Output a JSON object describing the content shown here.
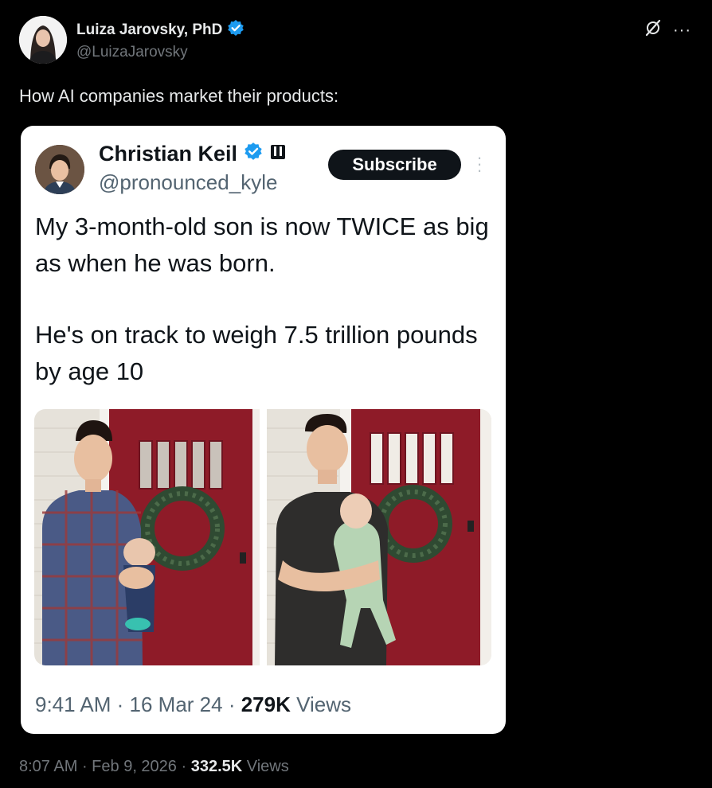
{
  "tweet": {
    "author_name": "Luiza Jarovsky, PhD",
    "author_handle": "@LuizaJarovsky",
    "text": "How AI companies market their products:",
    "time": "8:07 AM",
    "separator": " · ",
    "date": "Feb 9, 2026",
    "views_count": "332.5K",
    "views_label": " Views",
    "more_glyph": "···"
  },
  "quoted": {
    "author_name": "Christian Keil",
    "author_handle": "@pronounced_kyle",
    "subscribe_label": "Subscribe",
    "paragraph_1": "My 3-month-old son is now TWICE as big as when he was born.",
    "paragraph_2": "He's on track to weigh 7.5 trillion pounds by age 10",
    "time": "9:41 AM",
    "separator": " · ",
    "date": "16 Mar 24",
    "views_count": "279K",
    "views_label": " Views"
  },
  "colors": {
    "background": "#000000",
    "verified_badge": "#1d9bf0",
    "muted_text": "#71767b",
    "card_background": "#ffffff",
    "door_red": "#8e1b28"
  }
}
